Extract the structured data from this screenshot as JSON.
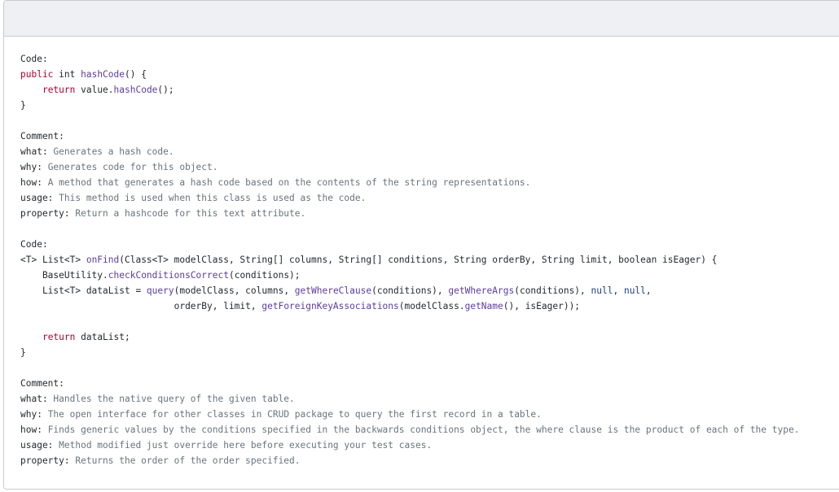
{
  "blocks": [
    {
      "code_label": "Code:",
      "code_lines": [
        [
          {
            "t": "public",
            "c": "kw"
          },
          {
            "t": " int ",
            "c": ""
          },
          {
            "t": "hashCode",
            "c": "fn"
          },
          {
            "t": "() {",
            "c": ""
          }
        ],
        [
          {
            "t": "    ",
            "c": ""
          },
          {
            "t": "return",
            "c": "kw"
          },
          {
            "t": " value.",
            "c": ""
          },
          {
            "t": "hashCode",
            "c": "fn"
          },
          {
            "t": "();",
            "c": ""
          }
        ],
        [
          {
            "t": "}",
            "c": ""
          }
        ]
      ],
      "comment_label": "Comment:",
      "comment_lines": [
        {
          "key": "what:",
          "value": " Generates a hash code."
        },
        {
          "key": "why:",
          "value": " Generates code for this object."
        },
        {
          "key": "how:",
          "value": " A method that generates a hash code based on the contents of the string representations."
        },
        {
          "key": "usage:",
          "value": " This method is used when this class is used as the code."
        },
        {
          "key": "property:",
          "value": " Return a hashcode for this text attribute."
        }
      ]
    },
    {
      "code_label": "Code:",
      "code_lines": [
        [
          {
            "t": "<T> List<T> ",
            "c": ""
          },
          {
            "t": "onFind",
            "c": "fn"
          },
          {
            "t": "(Class<T> modelClass, String[] columns, String[] conditions, String orderBy, String limit, boolean isEager) {",
            "c": ""
          }
        ],
        [
          {
            "t": "    BaseUtility.",
            "c": ""
          },
          {
            "t": "checkConditionsCorrect",
            "c": "fn"
          },
          {
            "t": "(conditions);",
            "c": ""
          }
        ],
        [
          {
            "t": "    List<T> dataList = ",
            "c": ""
          },
          {
            "t": "query",
            "c": "fn"
          },
          {
            "t": "(modelClass, columns, ",
            "c": ""
          },
          {
            "t": "getWhereClause",
            "c": "fn"
          },
          {
            "t": "(conditions), ",
            "c": ""
          },
          {
            "t": "getWhereArgs",
            "c": "fn"
          },
          {
            "t": "(conditions), ",
            "c": ""
          },
          {
            "t": "null",
            "c": "lit"
          },
          {
            "t": ", ",
            "c": ""
          },
          {
            "t": "null",
            "c": "lit"
          },
          {
            "t": ",",
            "c": ""
          }
        ],
        [
          {
            "t": "                            orderBy, limit, ",
            "c": ""
          },
          {
            "t": "getForeignKeyAssociations",
            "c": "fn"
          },
          {
            "t": "(modelClass.",
            "c": ""
          },
          {
            "t": "getName",
            "c": "fn"
          },
          {
            "t": "(), isEager));",
            "c": ""
          }
        ],
        [],
        [
          {
            "t": "    ",
            "c": ""
          },
          {
            "t": "return",
            "c": "kw"
          },
          {
            "t": " dataList;",
            "c": ""
          }
        ],
        [
          {
            "t": "}",
            "c": ""
          }
        ]
      ],
      "comment_label": "Comment:",
      "comment_lines": [
        {
          "key": "what:",
          "value": " Handles the native query of the given table."
        },
        {
          "key": "why:",
          "value": " The open interface for other classes in CRUD package to query the first record in a table."
        },
        {
          "key": "how:",
          "value": " Finds generic values by the conditions specified in the backwards conditions object, the where clause is the product of each of the type."
        },
        {
          "key": "usage:",
          "value": " Method modified just override here before executing your test cases."
        },
        {
          "key": "property:",
          "value": " Returns the order of the order specified."
        }
      ]
    }
  ]
}
